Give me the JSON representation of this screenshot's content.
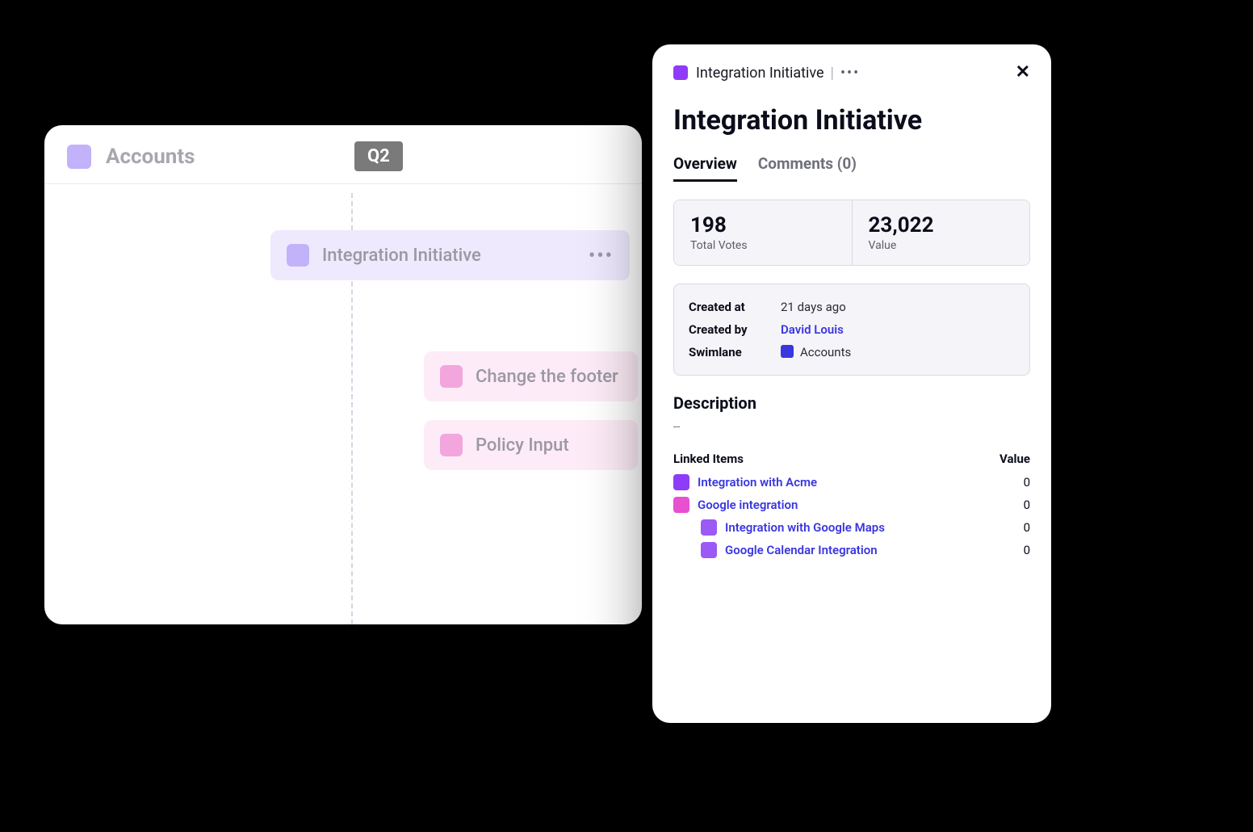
{
  "board": {
    "title": "Accounts",
    "quarter": "Q2",
    "cards": [
      {
        "label": "Integration Initiative"
      },
      {
        "label": "Change the footer"
      },
      {
        "label": "Policy Input"
      }
    ]
  },
  "panel": {
    "breadcrumb": "Integration Initiative",
    "title": "Integration Initiative",
    "tabs": {
      "overview": "Overview",
      "comments": "Comments (0)"
    },
    "stats": {
      "votes_value": "198",
      "votes_label": "Total Votes",
      "value_value": "23,022",
      "value_label": "Value"
    },
    "meta": {
      "created_at_k": "Created at",
      "created_at_v": "21 days ago",
      "created_by_k": "Created by",
      "created_by_v": "David Louis",
      "swimlane_k": "Swimlane",
      "swimlane_v": "Accounts"
    },
    "description_title": "Description",
    "description_body": "--",
    "linked_title": "Linked Items",
    "linked_value_title": "Value",
    "linked": {
      "r0_label": "Integration with Acme",
      "r0_value": "0",
      "r1_label": "Google integration",
      "r1_value": "0",
      "r2_label": "Integration with Google Maps",
      "r2_value": "0",
      "r3_label": "Google Calendar Integration",
      "r3_value": "0"
    }
  }
}
